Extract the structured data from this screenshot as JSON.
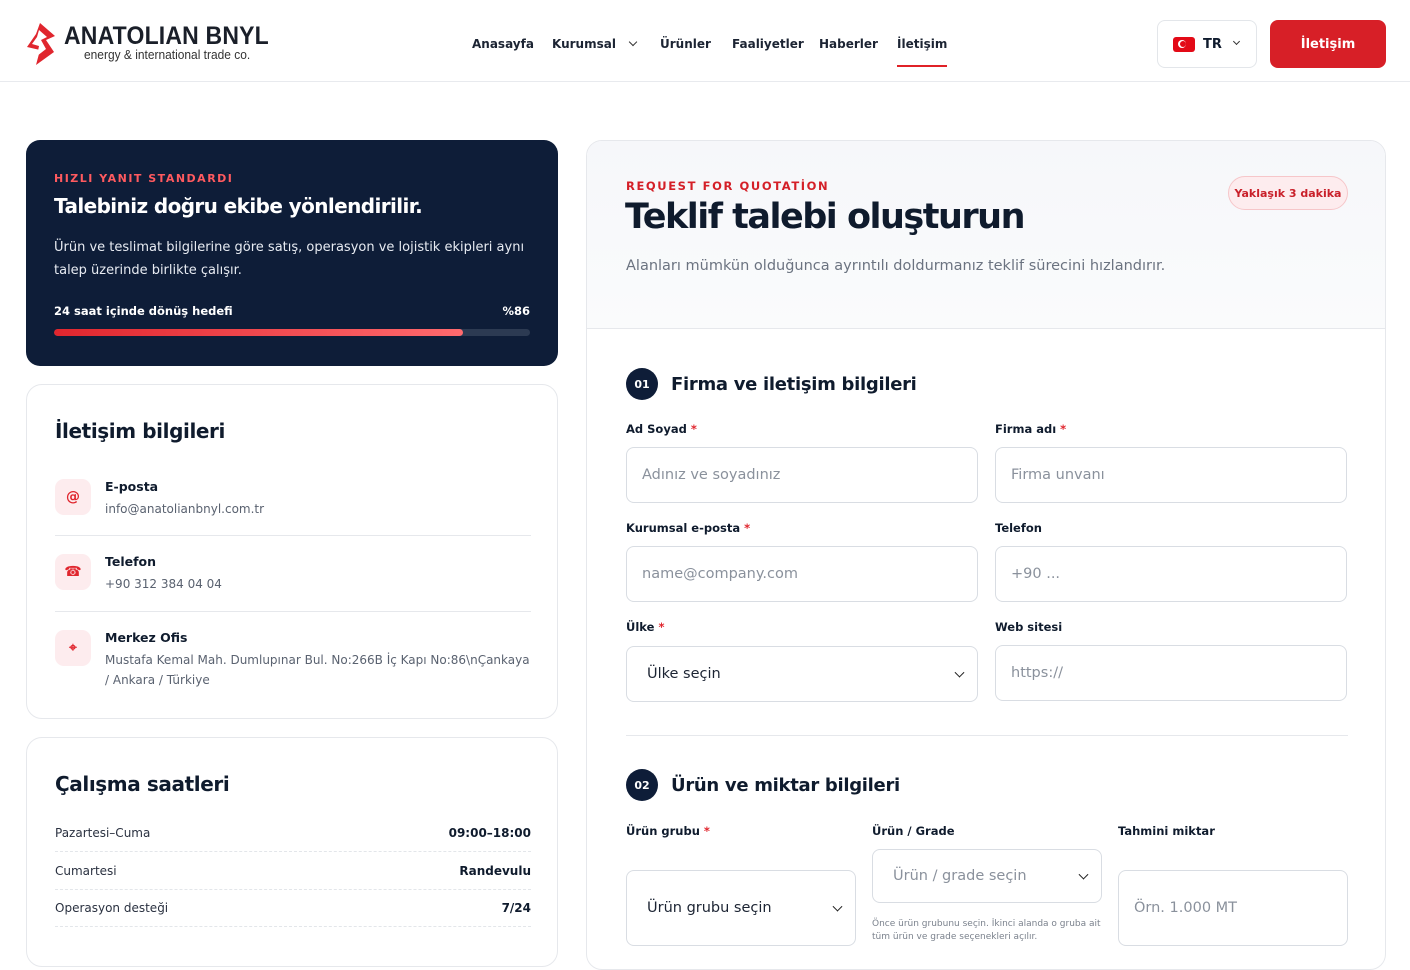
{
  "brand": {
    "name": "ANATOLIAN BNYL",
    "tagline": "energy & international trade co.",
    "accent": "#d71f27",
    "dark": "#0e1d38"
  },
  "nav": {
    "items": [
      "Anasayfa",
      "Kurumsal",
      "Ürünler",
      "Faaliyetler",
      "Haberler",
      "İletişim"
    ],
    "active": "İletişim"
  },
  "lang": {
    "code": "TR",
    "flag": "turkey-flag-icon"
  },
  "header_cta": "İletişim",
  "highlight": {
    "eyebrow": "HIZLI YANIT STANDARDI",
    "title": "Talebiniz doğru ekibe yönlendirilir.",
    "text": "Ürün ve teslimat bilgilerine göre satış, operasyon ve lojistik ekipleri aynı talep üzerinde birlikte çalışır.",
    "meta_label": "24 saat içinde dönüş hedefi",
    "meta_value": "%86",
    "progress": 0.86
  },
  "contact": {
    "title": "İletişim bilgileri",
    "items": [
      {
        "icon": "at-icon",
        "glyph": "@",
        "label": "E-posta",
        "value": "info@anatolianbnyl.com.tr"
      },
      {
        "icon": "phone-icon",
        "glyph": "☎",
        "label": "Telefon",
        "value": "+90 312 384 04 04"
      },
      {
        "icon": "location-pin-icon",
        "glyph": "⌖",
        "label": "Merkez Ofis",
        "value": "Mustafa Kemal Mah. Dumlupınar Bul. No:266B İç Kapı No:86\\nÇankaya / Ankara / Türkiye"
      }
    ]
  },
  "hours": {
    "title": "Çalışma saatleri",
    "rows": [
      {
        "label": "Pazartesi–Cuma",
        "value": "09:00–18:00"
      },
      {
        "label": "Cumartesi",
        "value": "Randevulu"
      },
      {
        "label": "Operasyon desteği",
        "value": "7/24"
      }
    ]
  },
  "form": {
    "eyebrow": "REQUEST FOR QUOTATİON",
    "title": "Teklif talebi oluşturun",
    "subtitle": "Alanları mümkün olduğunca ayrıntılı doldurmanız teklif sürecini hızlandırır.",
    "badge": "Yaklaşık 3 dakika",
    "step1": {
      "num": "01",
      "title": "Firma ve iletişim bilgileri"
    },
    "step2": {
      "num": "02",
      "title": "Ürün ve miktar bilgileri"
    },
    "fields": {
      "name": {
        "label": "Ad Soyad",
        "placeholder": "Adınız ve soyadınız"
      },
      "company": {
        "label": "Firma adı",
        "placeholder": "Firma unvanı"
      },
      "email": {
        "label": "Kurumsal e-posta",
        "placeholder": "name@company.com"
      },
      "phone": {
        "label": "Telefon",
        "placeholder": "+90 ..."
      },
      "country": {
        "label": "Ülke",
        "value": "Ülke seçin"
      },
      "website": {
        "label": "Web sitesi",
        "placeholder": "https://"
      },
      "group": {
        "label": "Ürün grubu",
        "value": "Ürün grubu seçin"
      },
      "grade": {
        "label": "Ürün / Grade",
        "value": "Ürün / grade seçin",
        "help": "Önce ürün grubunu seçin. İkinci alanda o gruba ait tüm ürün ve grade seçenekleri açılır."
      },
      "qty": {
        "label": "Tahmini miktar",
        "placeholder": "Örn. 1.000 MT"
      }
    },
    "required_mark": "*"
  }
}
